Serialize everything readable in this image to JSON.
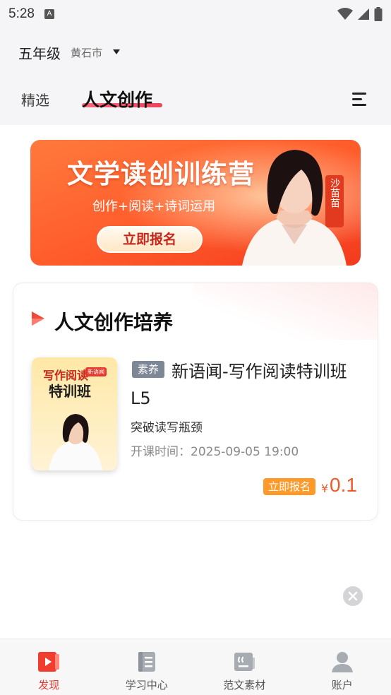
{
  "status_bar": {
    "time": "5:28",
    "notification_glyph": "A"
  },
  "header": {
    "grade": "五年级",
    "city": "黄石市",
    "tabs": [
      {
        "label": "精选",
        "active": false
      },
      {
        "label": "人文创作",
        "active": true
      }
    ]
  },
  "banner": {
    "title": "文学读创训练营",
    "subtitle": "创作+阅读+诗词运用",
    "cta": "立即报名",
    "teacher_name": "沙苗苗"
  },
  "section": {
    "title": "人文创作培养",
    "course": {
      "thumb_line1": "写作阅读",
      "thumb_line2": "特训班",
      "thumb_badge": "新语闻",
      "tag": "素养",
      "title": "新语闻-写作阅读特训班L5",
      "subtitle": "突破读写瓶颈",
      "time": "开课时间：2025-09-05 19:00",
      "enroll_label": "立即报名",
      "price_symbol": "¥",
      "price": "0.1"
    }
  },
  "bottom_nav": {
    "items": [
      {
        "label": "发现",
        "icon": "discover-icon",
        "active": true
      },
      {
        "label": "学习中心",
        "icon": "study-center-icon",
        "active": false
      },
      {
        "label": "范文素材",
        "icon": "essay-material-icon",
        "active": false
      },
      {
        "label": "账户",
        "icon": "account-icon",
        "active": false
      }
    ]
  },
  "colors": {
    "accent": "#e8372c",
    "price": "#f05a2a",
    "tag_gray": "#7d8796",
    "enroll_orange": "#ff9a2a"
  }
}
